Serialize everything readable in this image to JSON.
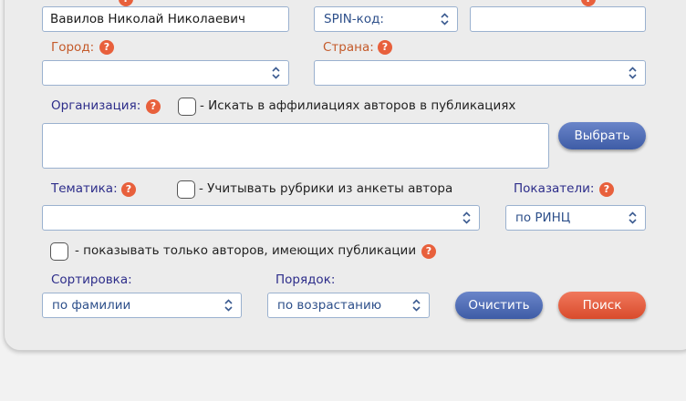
{
  "row1": {
    "name_value": "Вавилов Николай Николаевич",
    "id_type_value": "SPIN-код:",
    "id_value": ""
  },
  "city": {
    "label": "Город:",
    "value": ""
  },
  "country": {
    "label": "Страна:",
    "value": ""
  },
  "organization": {
    "label": "Организация:",
    "affiliation_checkbox_label": "- Искать в аффилиациях авторов в публикациях",
    "value": "",
    "select_button": "Выбрать"
  },
  "topic": {
    "label": "Тематика:",
    "rubrics_checkbox_label": "- Учитывать рубрики из анкеты автора",
    "value": ""
  },
  "indicators": {
    "label": "Показатели:",
    "value": "по РИНЦ"
  },
  "only_with_pubs_label": "- показывать только авторов, имеющих публикации",
  "sort": {
    "label": "Сортировка:",
    "value": "по фамилии"
  },
  "order": {
    "label": "Порядок:",
    "value": "по возрастанию"
  },
  "buttons": {
    "clear": "Очистить",
    "search": "Поиск"
  },
  "help_glyph": "?",
  "colors": {
    "label_orange": "#c45a2a",
    "label_navy": "#2d2d8a",
    "help_orange": "#e8603c",
    "button_blue": "#4a67b0",
    "button_red": "#e2573a",
    "field_border": "#9ab1cf"
  }
}
